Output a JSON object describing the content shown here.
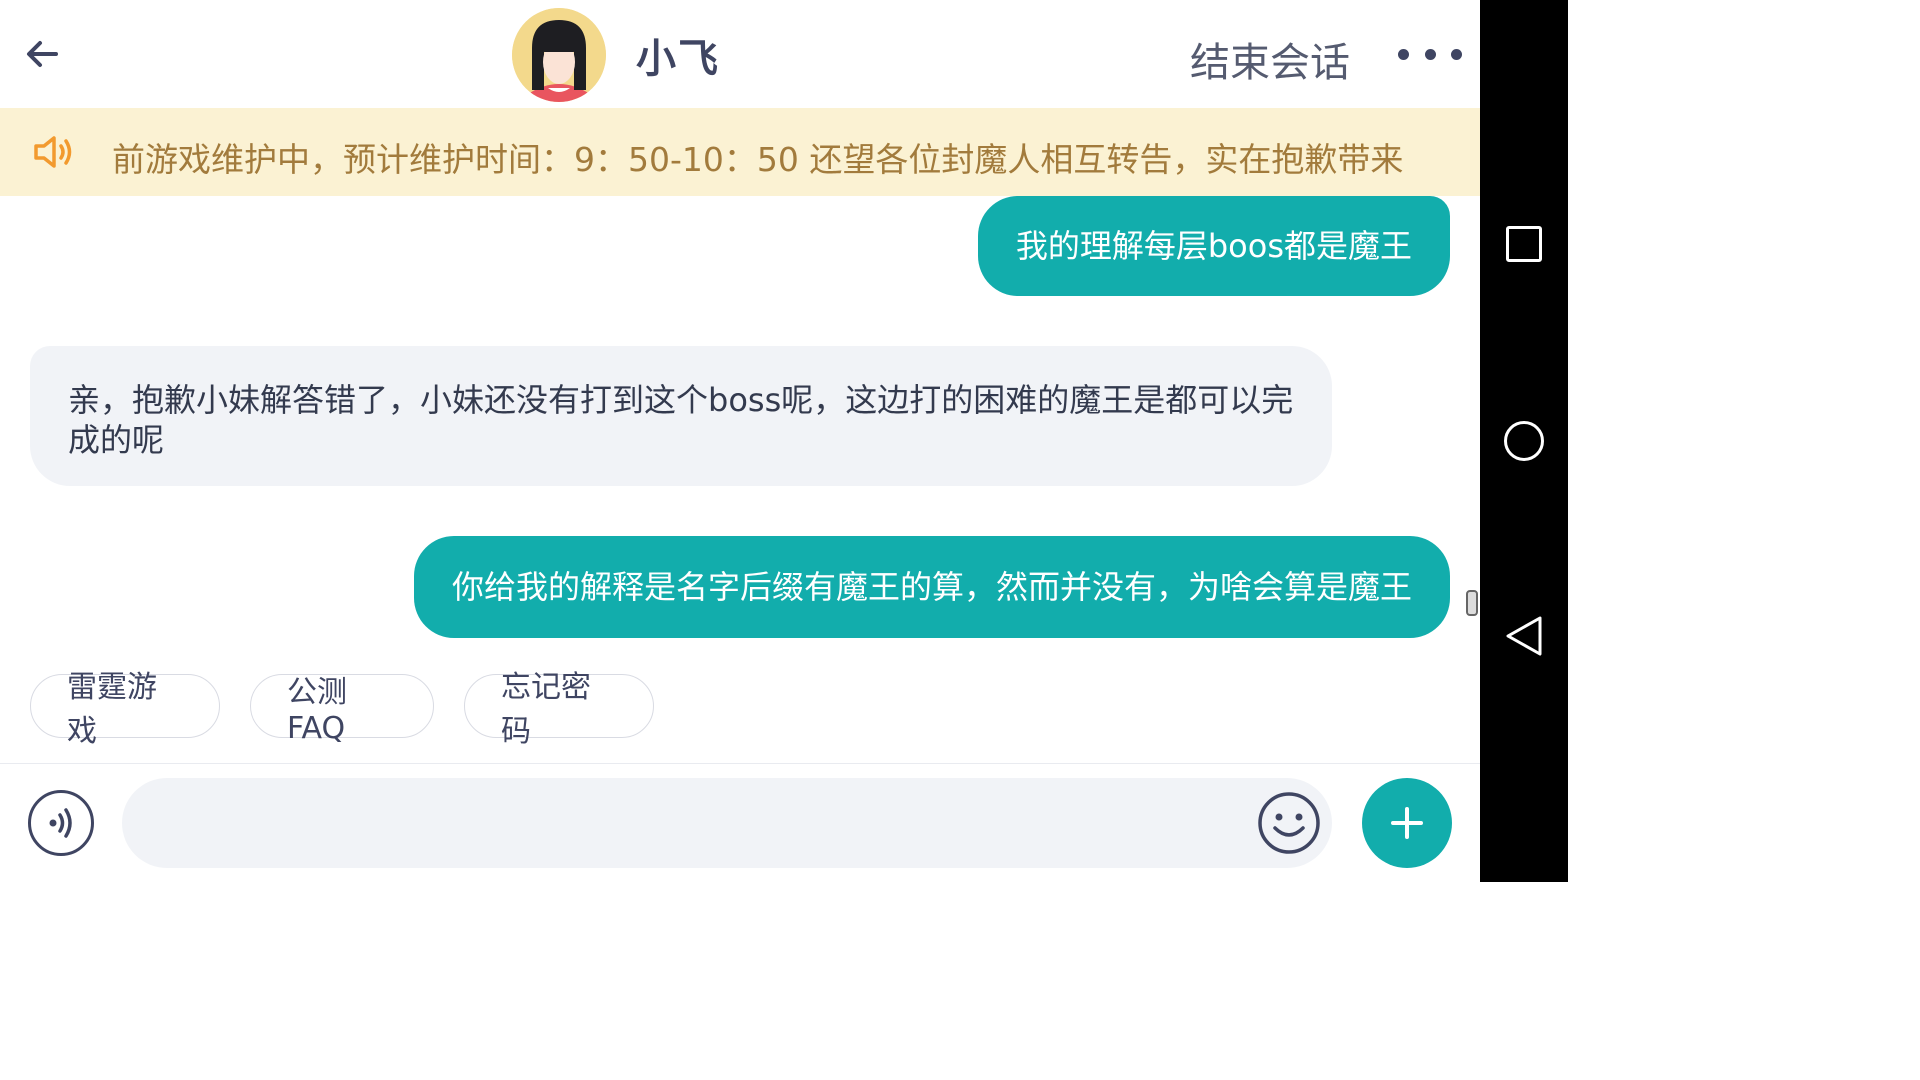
{
  "header": {
    "agent_name": "小飞",
    "end_session_label": "结束会话"
  },
  "notice": {
    "text": "前游戏维护中，预计维护时间：9：50-10：50 还望各位封魔人相互转告，实在抱歉带来"
  },
  "messages": [
    {
      "from": "user",
      "text": "我的理解每层boos都是魔王"
    },
    {
      "from": "agent",
      "text": "亲，抱歉小妹解答错了，小妹还没有打到这个boss呢，这边打的困难的魔王是都可以完成的呢"
    },
    {
      "from": "user",
      "text": "你给我的解释是名字后缀有魔王的算，然而并没有，为啥会算是魔王"
    }
  ],
  "quick_replies": [
    "雷霆游戏",
    "公测FAQ",
    "忘记密码"
  ],
  "input": {
    "value": "",
    "placeholder": ""
  },
  "colors": {
    "accent": "#12adac",
    "notice_bg": "#fbf2d3",
    "notice_text": "#a27b3c",
    "bubble_in": "#f1f3f7",
    "title": "#3f4562"
  },
  "icons": [
    "back-arrow-icon",
    "avatar",
    "more-dots-icon",
    "speaker-icon",
    "voice-icon",
    "emoji-icon",
    "plus-icon",
    "nav-recent-icon",
    "nav-home-icon",
    "nav-back-icon"
  ]
}
